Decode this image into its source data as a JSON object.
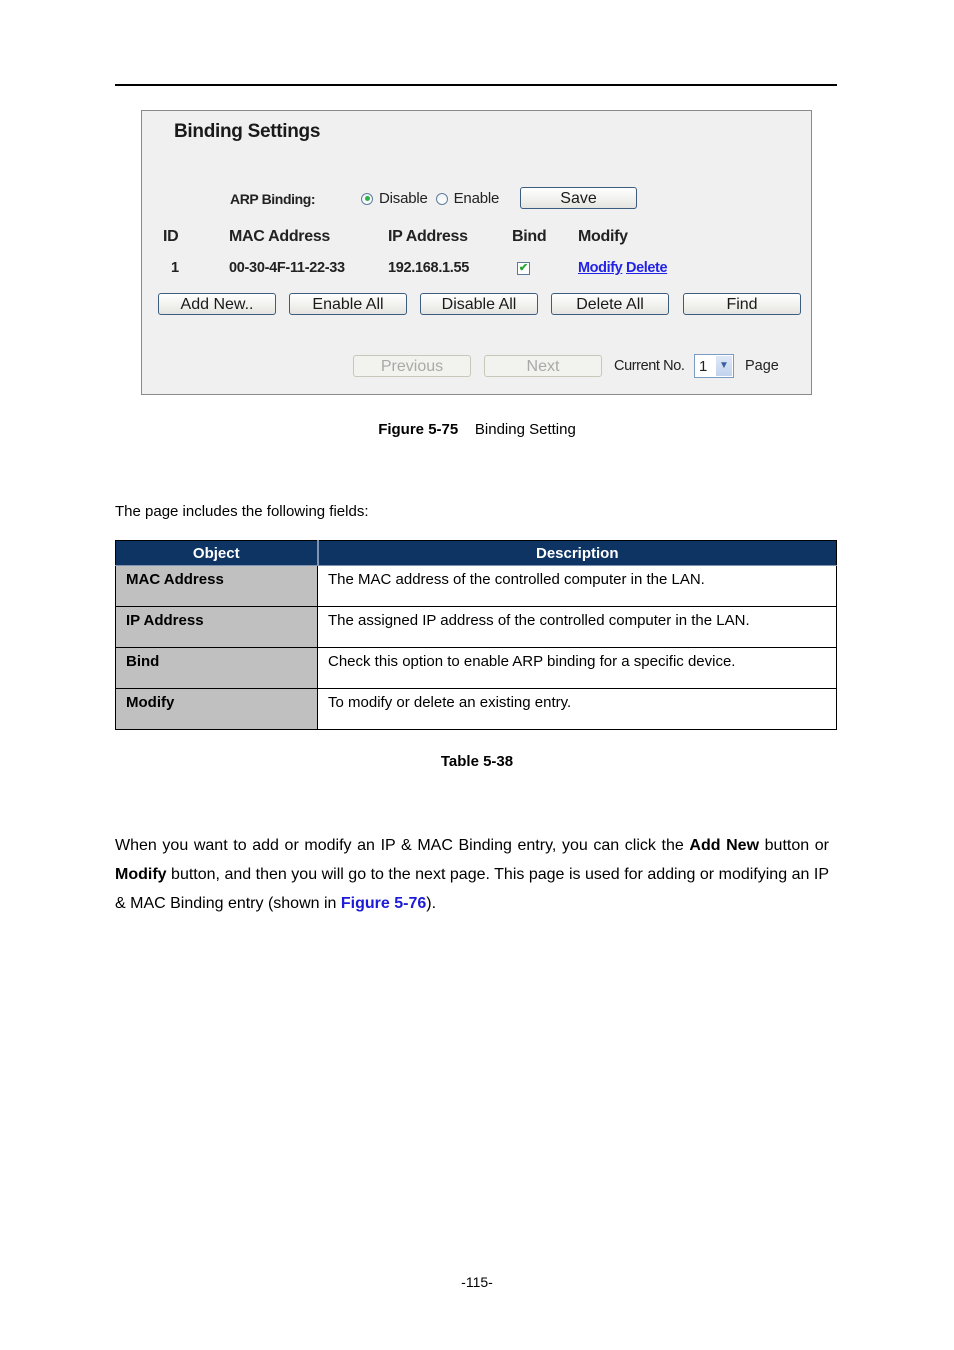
{
  "figure": {
    "title": "Binding Settings",
    "arp_binding": {
      "label": "ARP Binding:",
      "options": [
        {
          "label": "Disable",
          "selected": true
        },
        {
          "label": "Enable",
          "selected": false
        }
      ],
      "save_label": "Save"
    },
    "table": {
      "headers": [
        "ID",
        "MAC Address",
        "IP Address",
        "Bind",
        "Modify"
      ],
      "rows": [
        {
          "id": "1",
          "mac": "00-30-4F-11-22-33",
          "ip": "192.168.1.55",
          "bind": true,
          "modify_label": "Modify",
          "delete_label": "Delete"
        }
      ]
    },
    "buttons": [
      "Add New..",
      "Enable All",
      "Disable All",
      "Delete All",
      "Find"
    ],
    "pagination": {
      "previous_label": "Previous",
      "next_label": "Next",
      "current_label": "Current No.",
      "current_value": "1",
      "page_label": "Page"
    },
    "checkmark": "✔",
    "dropdown_arrow": "▼"
  },
  "caption": {
    "figure_number": "Figure 5-75",
    "figure_title": "Binding Setting"
  },
  "intro_text": "The page includes the following fields:",
  "fields_table": {
    "headers": [
      "Object",
      "Description"
    ],
    "rows": [
      {
        "object": "MAC Address",
        "description": "The MAC address of the controlled computer in the LAN."
      },
      {
        "object": "IP Address",
        "description": "The assigned IP address of the controlled computer in the LAN."
      },
      {
        "object": "Bind",
        "description": "Check this option to enable ARP binding for a specific device."
      },
      {
        "object": "Modify",
        "description": "To modify or delete an existing entry."
      }
    ],
    "caption": "Table 5-38"
  },
  "paragraph": {
    "part1": "When you want to add or modify an IP & MAC Binding entry, you can click the ",
    "bold1": "Add New",
    "part2": " button or ",
    "bold2": "Modify",
    "part3": " button, and then you will go to the next page. This page is used for adding or modifying an IP & MAC Binding entry (shown in ",
    "ref": "Figure 5-76",
    "part4": ")."
  },
  "page_number": "-115-",
  "colors": {
    "table_header_bg": "#0e3463",
    "object_cell_bg": "#c0c0c0",
    "link": "#2323e6",
    "reference": "#1b1bd8"
  }
}
